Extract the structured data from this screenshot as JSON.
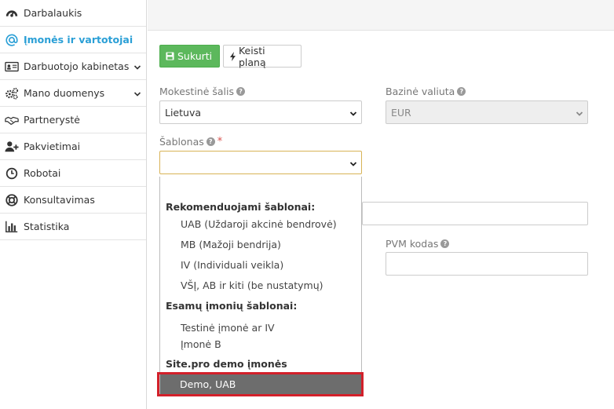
{
  "sidebar": {
    "items": [
      {
        "label": "Darbalaukis",
        "icon": "dashboard-icon"
      },
      {
        "label": "Įmonės ir vartotojai",
        "icon": "at-icon"
      },
      {
        "label": "Darbuotojo kabinetas",
        "icon": "id-card-icon"
      },
      {
        "label": "Mano duomenys",
        "icon": "gears-icon"
      },
      {
        "label": "Partnerystė",
        "icon": "handshake-icon"
      },
      {
        "label": "Pakvietimai",
        "icon": "user-plus-icon"
      },
      {
        "label": "Robotai",
        "icon": "clock-icon"
      },
      {
        "label": "Konsultavimas",
        "icon": "lifebuoy-icon"
      },
      {
        "label": "Statistika",
        "icon": "bar-chart-icon"
      }
    ],
    "active_index": 1
  },
  "toolbar": {
    "create_label": "Sukurti",
    "plan_label": "Keisti planą"
  },
  "form": {
    "tax_country_label": "Mokestinė šalis",
    "tax_country_value": "Lietuva",
    "base_currency_label": "Bazinė valiuta",
    "base_currency_value": "EUR",
    "template_label": "Šablonas",
    "template_required": "*",
    "template_value": "",
    "vat_code_label": "PVM kodas",
    "vat_code_value": ""
  },
  "dropdown": {
    "groups": [
      {
        "label": "Rekomenduojami šablonai:",
        "options": [
          "UAB (Uždaroji akcinė bendrovė)",
          "MB (Mažoji bendrija)",
          "IV (Individuali veikla)",
          "VŠĮ, AB ir kiti (be nustatymų)"
        ]
      },
      {
        "label": "Esamų įmonių šablonai:",
        "options": [
          "Testinė įmonė ar IV",
          "Įmonė B"
        ]
      },
      {
        "label": "Site.pro demo įmonės",
        "options": [
          "Demo, UAB"
        ]
      }
    ],
    "selected": "Demo, UAB"
  },
  "colors": {
    "accent": "#2a9fd6",
    "create_button": "#5cb85c",
    "selected_option": "#6d6d6d",
    "highlight_border": "#d3202a"
  }
}
